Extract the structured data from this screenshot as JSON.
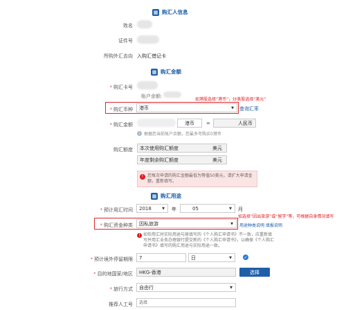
{
  "sections": {
    "buyer_info": "购汇人信息",
    "amount": "购汇金额",
    "purpose": "购汇用途"
  },
  "buyer": {
    "name_label": "姓名",
    "id_label": "证件号",
    "direction_label": "所购外汇去向",
    "direction_value": "入购汇借记卡"
  },
  "card": {
    "label": "购汇卡号",
    "balance_label": "账户余额:"
  },
  "currency": {
    "label": "购汇币种",
    "value": "港币",
    "rate_link": "查询汇率",
    "annotation": "如港股选择“港币”，炒美股选择“美元”"
  },
  "amount": {
    "label": "购汇金额",
    "foreign_currency": "港币",
    "equals": "=",
    "local_currency": "人民币",
    "hint": "根据您当前账户余额，您最多可购买0港币"
  },
  "quota": {
    "label": "购汇额度",
    "used_label": "本次使用购汇额度",
    "remaining_label": "年度剩余购汇额度",
    "unit": "美元",
    "warning": "您每次申请的购汇金额最低为等值50美元，请扩大申请金额，重新填写。"
  },
  "purpose": {
    "time_label": "预计用汇时间",
    "year": "2018",
    "year_unit": "年",
    "month": "05",
    "month_unit": "月",
    "type_label": "购汇资金种类",
    "type_value": "因私旅游",
    "type_annotation": "如选择“因出旅游”或“留学”等，可根据自身情况填写",
    "type_links": "用途种类说明  填报说明",
    "notice": "如你用汇时实际用途与原填写的《个人购汇申请书》不一致，应重新填写并用汇业务办理银行提交新的《个人购汇申请书》，以确保《个人购汇申请书》填写的购汇用途与实际用途一致。",
    "stay_label": "预计境外停留期限",
    "stay_value": "7",
    "stay_unit": "日",
    "dest_label": "目的地国家/地区",
    "dest_value": "HKG-香港",
    "select_button": "选择",
    "travel_label": "旅行方式",
    "travel_value": "自由行",
    "referrer_label": "推荐人工号",
    "referrer_placeholder": "选填"
  },
  "colors": {
    "accent": "#1f5fa8",
    "annotation_red": "#e0191f"
  }
}
